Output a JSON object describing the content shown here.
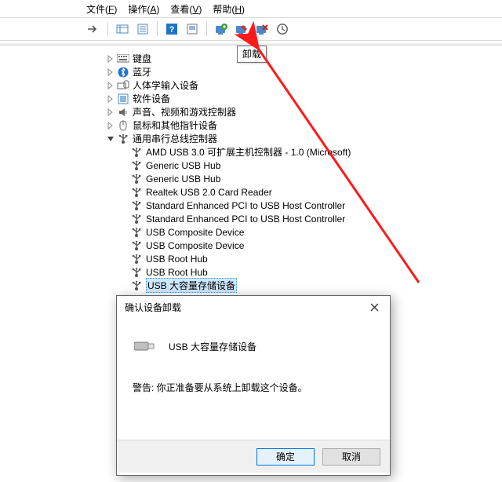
{
  "menu": {
    "file": "文件(F)",
    "action": "操作(A)",
    "view": "查看(V)",
    "help": "帮助(H)"
  },
  "tooltip": "卸载",
  "tree": {
    "keyboard": "键盘",
    "bluetooth": "蓝牙",
    "hid": "人体学输入设备",
    "software": "软件设备",
    "avgc": "声音、视频和游戏控制器",
    "mouse": "鼠标和其他指针设备",
    "usbctrl": "通用串行总线控制器",
    "children": [
      "AMD USB 3.0 可扩展主机控制器 - 1.0 (Microsoft)",
      "Generic USB Hub",
      "Generic USB Hub",
      "Realtek USB 2.0 Card Reader",
      "Standard Enhanced PCI to USB Host Controller",
      "Standard Enhanced PCI to USB Host Controller",
      "USB Composite Device",
      "USB Composite Device",
      "USB Root Hub",
      "USB Root Hub",
      "USB 大容量存储设备"
    ]
  },
  "dialog": {
    "title": "确认设备卸载",
    "device": "USB 大容量存储设备",
    "warning": "警告: 你正准备要从系统上卸载这个设备。",
    "ok": "确定",
    "cancel": "取消"
  }
}
